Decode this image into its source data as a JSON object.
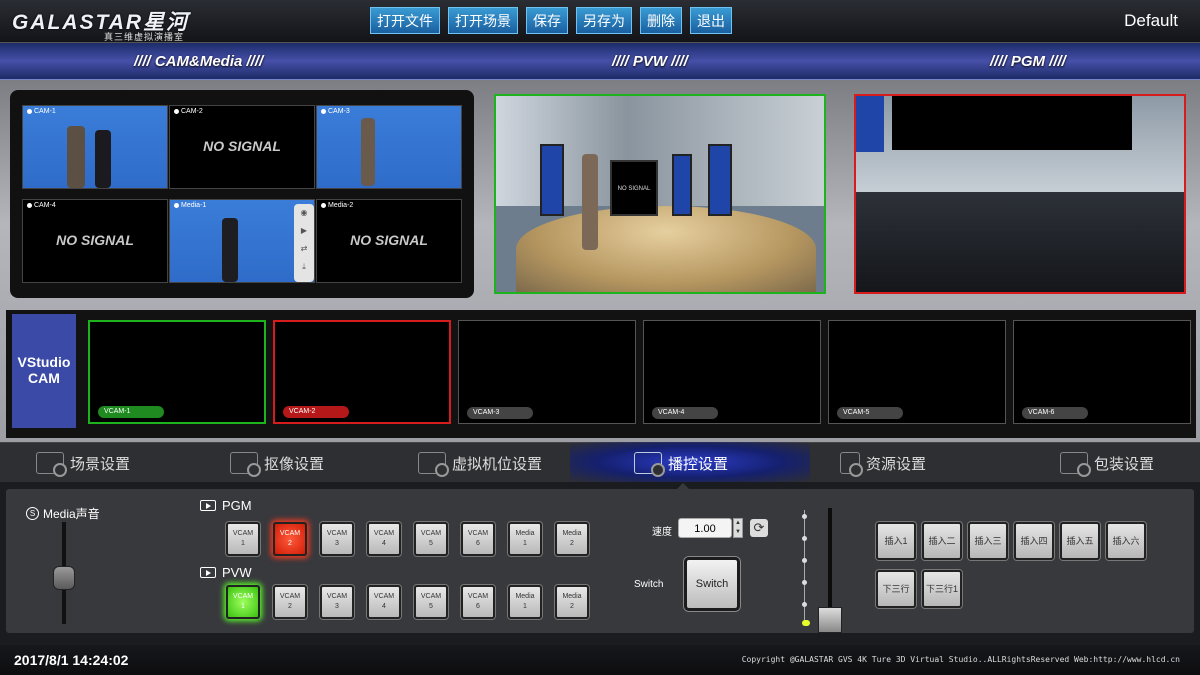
{
  "app": {
    "logo_text": "GALASTAR星河",
    "logo_sub": "真三维虚拟演播室",
    "preset": "Default"
  },
  "menu": [
    "打开文件",
    "打开场景",
    "保存",
    "另存为",
    "删除",
    "退出"
  ],
  "sections": {
    "cam_media": "//// CAM&Media ////",
    "pvw": "//// PVW ////",
    "pgm": "//// PGM ////"
  },
  "sources": [
    {
      "label": "CAM-1",
      "signal": ""
    },
    {
      "label": "CAM-2",
      "signal": "NO SIGNAL"
    },
    {
      "label": "CAM-3",
      "signal": ""
    },
    {
      "label": "CAM-4",
      "signal": "NO SIGNAL"
    },
    {
      "label": "Media-1",
      "signal": ""
    },
    {
      "label": "Media-2",
      "signal": "NO SIGNAL"
    }
  ],
  "pvw_screen_text": "NO SIGNAL",
  "vstudio_label": "VStudio CAM",
  "vcams": [
    "VCAM-1",
    "VCAM-2",
    "VCAM-3",
    "VCAM-4",
    "VCAM-5",
    "VCAM-6"
  ],
  "tabs": [
    "场景设置",
    "抠像设置",
    "虚拟机位设置",
    "播控设置",
    "资源设置",
    "包装设置"
  ],
  "active_tab": "播控设置",
  "control": {
    "media_audio": "Media声音",
    "pgm_label": "PGM",
    "pvw_label": "PVW",
    "keys": [
      [
        "VCAM",
        "1"
      ],
      [
        "VCAM",
        "2"
      ],
      [
        "VCAM",
        "3"
      ],
      [
        "VCAM",
        "4"
      ],
      [
        "VCAM",
        "5"
      ],
      [
        "VCAM",
        "6"
      ],
      [
        "Media",
        "1"
      ],
      [
        "Media",
        "2"
      ]
    ],
    "pgm_selected": "VCAM 2",
    "pvw_selected": "VCAM 1",
    "speed_label": "速度",
    "speed_value": "1.00",
    "switch_label": "Switch",
    "switch_button": "Switch",
    "insert_buttons": [
      "插入1",
      "插入二",
      "插入三",
      "插入四",
      "插入五",
      "插入六",
      "下三行",
      "下三行1"
    ]
  },
  "footer": {
    "datetime": "2017/8/1 14:24:02",
    "copyright": "Copyright @GALASTAR GVS 4K Ture 3D Virtual Studio..ALLRightsReserved Web:http://www.hlcd.cn"
  },
  "colors": {
    "pgm_red": "#d61c1c",
    "pvw_green": "#1db31d",
    "accent_blue": "#2b3cc8"
  }
}
